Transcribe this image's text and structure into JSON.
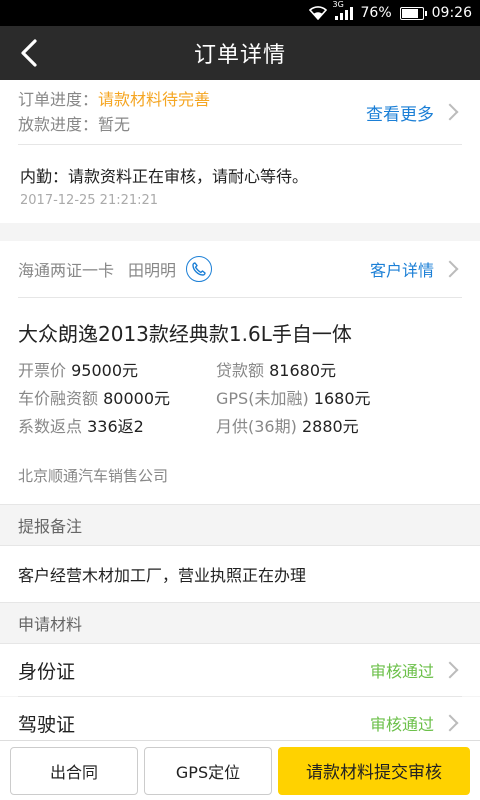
{
  "status_bar": {
    "network": "3G",
    "battery": "76%",
    "battery_level": 0.76,
    "time": "09:26"
  },
  "header": {
    "title": "订单详情"
  },
  "progress": {
    "order_label": "订单进度：",
    "order_value": "请款材料待完善",
    "loan_label": "放款进度：",
    "loan_value": "暂无",
    "more_link": "查看更多"
  },
  "message": {
    "text": "内勤：请款资料正在审核，请耐心等待。",
    "timestamp": "2017-12-25  21:21:21"
  },
  "customer": {
    "product": "海通两证一卡",
    "name": "田明明",
    "detail_link": "客户详情"
  },
  "car": {
    "model": "大众朗逸2013款经典款1.6L手自一体",
    "fields": [
      {
        "label": "开票价",
        "value": "95000元"
      },
      {
        "label": "贷款额",
        "value": "81680元"
      },
      {
        "label": "车价融资额",
        "value": "80000元"
      },
      {
        "label": "GPS(未加融)",
        "value": "1680元"
      },
      {
        "label": "系数返点",
        "value": "336返2"
      },
      {
        "label": "月供(36期)",
        "value": "2880元"
      }
    ],
    "company": "北京顺通汽车销售公司"
  },
  "remarks": {
    "header": "提报备注",
    "text": "客户经营木材加工厂，营业执照正在办理"
  },
  "materials": {
    "header": "申请材料",
    "items": [
      {
        "name": "身份证",
        "status": "审核通过"
      },
      {
        "name": "驾驶证",
        "status": "审核通过"
      }
    ]
  },
  "footer": {
    "contract_button": "出合同",
    "gps_button": "GPS定位",
    "submit_button": "请款材料提交审核"
  },
  "colors": {
    "accent_orange": "#f5a623",
    "link_blue": "#1b7fd6",
    "approved_green": "#6cc04a",
    "primary_yellow": "#ffd200",
    "navbar": "#2b2b2b"
  }
}
